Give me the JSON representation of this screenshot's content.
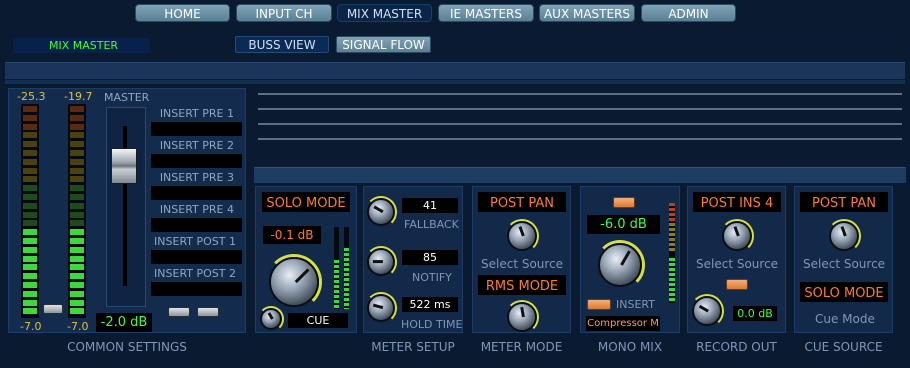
{
  "nav": {
    "tabs": [
      {
        "label": "HOME"
      },
      {
        "label": "INPUT CH"
      },
      {
        "label": "MIX MASTER"
      },
      {
        "label": "IE MASTERS"
      },
      {
        "label": "AUX MASTERS"
      },
      {
        "label": "ADMIN"
      }
    ]
  },
  "title": "MIX MASTER",
  "views": {
    "buss_view": "BUSS VIEW",
    "signal_flow": "SIGNAL FLOW"
  },
  "common": {
    "meter_left_peak": "-25.3",
    "meter_right_peak": "-19.7",
    "meter_left_bottom": "-7.0",
    "meter_right_bottom": "-7.0",
    "master_label": "MASTER",
    "fader_value": "-2.0 dB",
    "inserts": [
      "INSERT PRE 1",
      "INSERT PRE 2",
      "INSERT PRE 3",
      "INSERT PRE 4",
      "INSERT POST 1",
      "INSERT POST 2"
    ],
    "section_label": "COMMON SETTINGS"
  },
  "solo": {
    "mode_label": "SOLO MODE",
    "level": "-0.1 dB",
    "cue_value": "CUE"
  },
  "meter_setup": {
    "fallback_value": "41",
    "fallback_label": "FALLBACK",
    "notify_value": "85",
    "notify_label": "NOTIFY",
    "hold_value": "522 ms",
    "hold_label": "HOLD TIME",
    "section_label": "METER SETUP"
  },
  "meter_mode": {
    "post_pan": "POST PAN",
    "select_source": "Select Source",
    "rms_mode": "RMS MODE",
    "section_label": "METER MODE"
  },
  "mono_mix": {
    "level": "-6.0 dB",
    "insert_label": "INSERT",
    "insert_value": "Compressor M",
    "section_label": "MONO MIX"
  },
  "record_out": {
    "post_ins": "POST INS 4",
    "select_source": "Select Source",
    "level": "0.0 dB",
    "section_label": "RECORD OUT"
  },
  "cue_source": {
    "post_pan": "POST PAN",
    "select_source": "Select Source",
    "solo_mode": "SOLO MODE",
    "cue_mode": "Cue Mode",
    "section_label": "CUE SOURCE"
  },
  "colors": {
    "background": "#0a1a30",
    "panel": "#12294a",
    "accent_orange": "#ff7a2a",
    "accent_green": "#3cff3c",
    "peak_yellow": "#e0c040"
  }
}
